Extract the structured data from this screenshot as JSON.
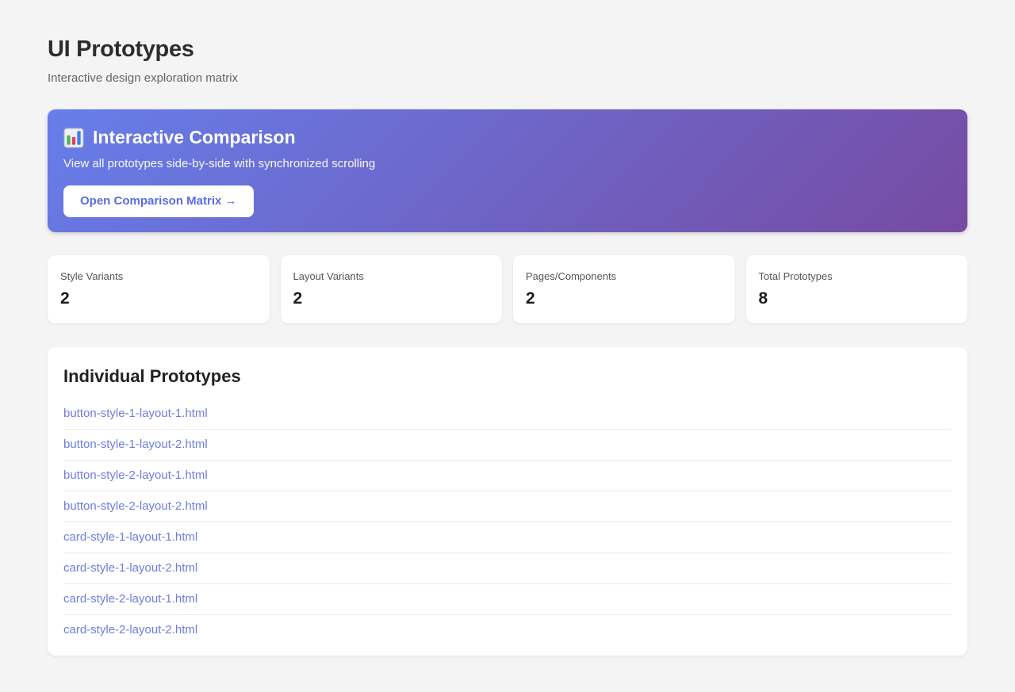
{
  "page": {
    "title": "UI Prototypes",
    "subtitle": "Interactive design exploration matrix"
  },
  "banner": {
    "icon": "bar-chart-icon",
    "title": "Interactive Comparison",
    "description": "View all prototypes side-by-side with synchronized scrolling",
    "button_label": "Open Comparison Matrix →"
  },
  "stats": [
    {
      "label": "Style Variants",
      "value": "2"
    },
    {
      "label": "Layout Variants",
      "value": "2"
    },
    {
      "label": "Pages/Components",
      "value": "2"
    },
    {
      "label": "Total Prototypes",
      "value": "8"
    }
  ],
  "prototypes": {
    "heading": "Individual Prototypes",
    "links": [
      "button-style-1-layout-1.html",
      "button-style-1-layout-2.html",
      "button-style-2-layout-1.html",
      "button-style-2-layout-2.html",
      "card-style-1-layout-1.html",
      "card-style-1-layout-2.html",
      "card-style-2-layout-1.html",
      "card-style-2-layout-2.html"
    ]
  },
  "colors": {
    "gradient_start": "#667eea",
    "gradient_end": "#764ba2",
    "link": "#6e7de2",
    "button_text": "#5b6ce0"
  }
}
